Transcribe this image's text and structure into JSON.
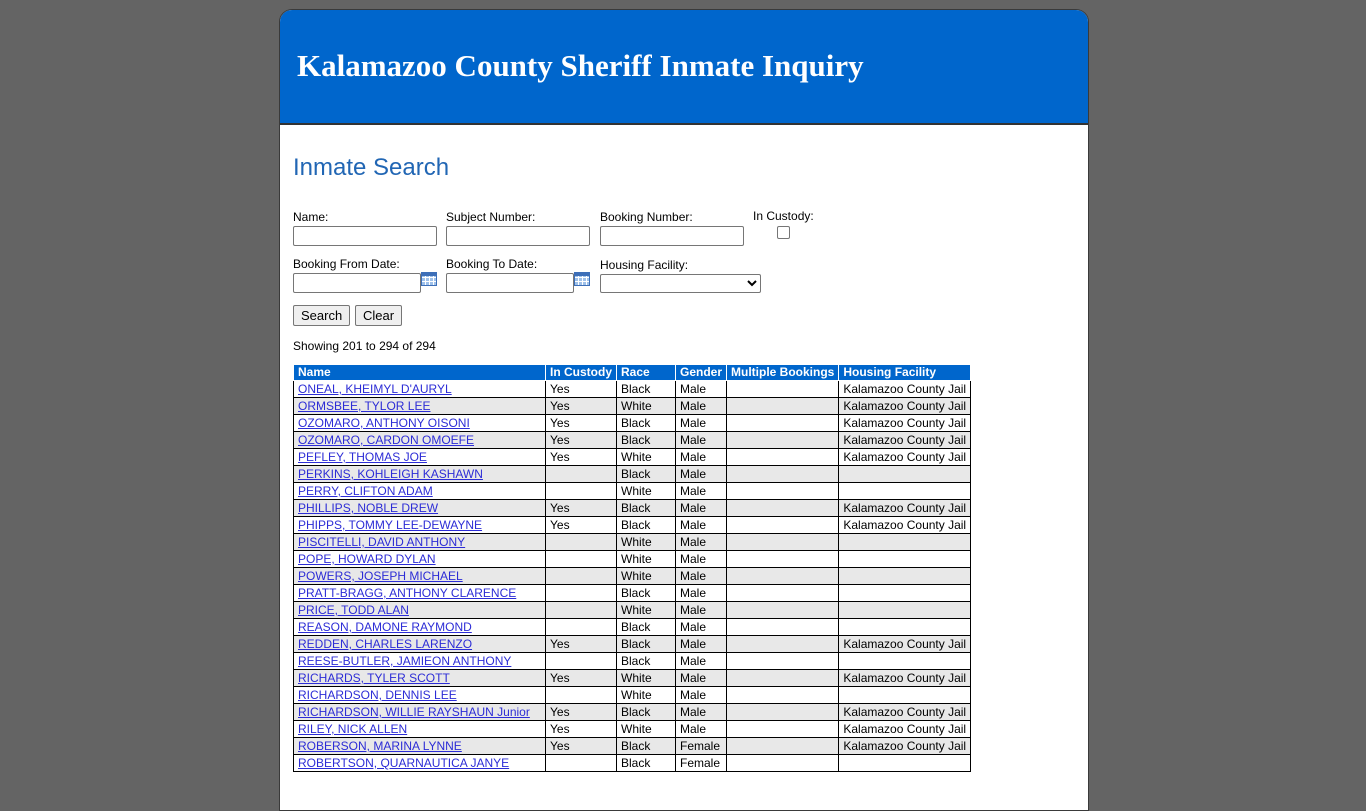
{
  "header": {
    "title": "Kalamazoo County Sheriff Inmate Inquiry"
  },
  "search": {
    "title": "Inmate Search",
    "name_label": "Name:",
    "subject_label": "Subject Number:",
    "booking_label": "Booking Number:",
    "custody_label": "In Custody:",
    "from_label": "Booking From Date:",
    "to_label": "Booking To Date:",
    "housing_label": "Housing Facility:",
    "search_button": "Search",
    "clear_button": "Clear"
  },
  "results": {
    "status": "Showing 201 to 294 of 294",
    "columns": [
      "Name",
      "In Custody",
      "Race",
      "Gender",
      "Multiple Bookings",
      "Housing Facility"
    ],
    "rows": [
      [
        "ONEAL, KHEIMYL D'AURYL",
        "Yes",
        "Black",
        "Male",
        "",
        "Kalamazoo County Jail"
      ],
      [
        "ORMSBEE, TYLOR LEE",
        "Yes",
        "White",
        "Male",
        "",
        "Kalamazoo County Jail"
      ],
      [
        "OZOMARO, ANTHONY OISONI",
        "Yes",
        "Black",
        "Male",
        "",
        "Kalamazoo County Jail"
      ],
      [
        "OZOMARO, CARDON OMOEFE",
        "Yes",
        "Black",
        "Male",
        "",
        "Kalamazoo County Jail"
      ],
      [
        "PEFLEY, THOMAS JOE",
        "Yes",
        "White",
        "Male",
        "",
        "Kalamazoo County Jail"
      ],
      [
        "PERKINS, KOHLEIGH KASHAWN",
        "",
        "Black",
        "Male",
        "",
        ""
      ],
      [
        "PERRY, CLIFTON ADAM",
        "",
        "White",
        "Male",
        "",
        ""
      ],
      [
        "PHILLIPS, NOBLE DREW",
        "Yes",
        "Black",
        "Male",
        "",
        "Kalamazoo County Jail"
      ],
      [
        "PHIPPS, TOMMY LEE-DEWAYNE",
        "Yes",
        "Black",
        "Male",
        "",
        "Kalamazoo County Jail"
      ],
      [
        "PISCITELLI, DAVID ANTHONY",
        "",
        "White",
        "Male",
        "",
        ""
      ],
      [
        "POPE, HOWARD DYLAN",
        "",
        "White",
        "Male",
        "",
        ""
      ],
      [
        "POWERS, JOSEPH MICHAEL",
        "",
        "White",
        "Male",
        "",
        ""
      ],
      [
        "PRATT-BRAGG, ANTHONY CLARENCE",
        "",
        "Black",
        "Male",
        "",
        ""
      ],
      [
        "PRICE, TODD ALAN",
        "",
        "White",
        "Male",
        "",
        ""
      ],
      [
        "REASON, DAMONE RAYMOND",
        "",
        "Black",
        "Male",
        "",
        ""
      ],
      [
        "REDDEN, CHARLES LARENZO",
        "Yes",
        "Black",
        "Male",
        "",
        "Kalamazoo County Jail"
      ],
      [
        "REESE-BUTLER, JAMIEON ANTHONY",
        "",
        "Black",
        "Male",
        "",
        ""
      ],
      [
        "RICHARDS, TYLER SCOTT",
        "Yes",
        "White",
        "Male",
        "",
        "Kalamazoo County Jail"
      ],
      [
        "RICHARDSON, DENNIS LEE",
        "",
        "White",
        "Male",
        "",
        ""
      ],
      [
        "RICHARDSON, WILLIE RAYSHAUN Junior",
        "Yes",
        "Black",
        "Male",
        "",
        "Kalamazoo County Jail"
      ],
      [
        "RILEY, NICK ALLEN",
        "Yes",
        "White",
        "Male",
        "",
        "Kalamazoo County Jail"
      ],
      [
        "ROBERSON, MARINA LYNNE",
        "Yes",
        "Black",
        "Female",
        "",
        "Kalamazoo County Jail"
      ],
      [
        "ROBERTSON, QUARNAUTICA JANYE",
        "",
        "Black",
        "Female",
        "",
        ""
      ]
    ]
  }
}
